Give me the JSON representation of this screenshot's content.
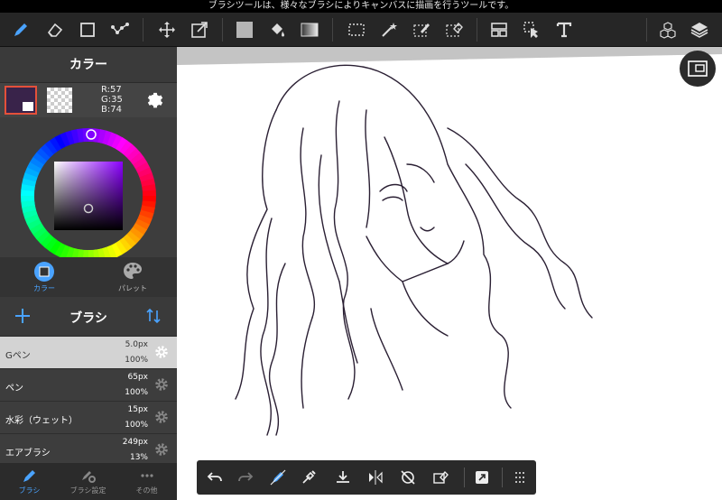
{
  "tooltip": "ブラシツールは、様々なブラシによりキャンバスに描画を行うツールです。",
  "color_panel": {
    "title": "カラー",
    "primary_color": "#39234a",
    "rgb": {
      "r": "R:57",
      "g": "G:35",
      "b": "B:74"
    },
    "tabs": [
      {
        "label": "カラー",
        "icon": "color-circle-icon",
        "active": true
      },
      {
        "label": "パレット",
        "icon": "palette-icon",
        "active": false
      }
    ]
  },
  "brush_panel": {
    "title": "ブラシ",
    "brushes": [
      {
        "name": "Gペン",
        "size": "5.0px",
        "opacity": "100%",
        "selected": true
      },
      {
        "name": "ペン",
        "size": "65px",
        "opacity": "100%",
        "selected": false
      },
      {
        "name": "水彩（ウェット）",
        "size": "15px",
        "opacity": "100%",
        "selected": false
      },
      {
        "name": "エアブラシ",
        "size": "249px",
        "opacity": "13%",
        "selected": false
      }
    ]
  },
  "bottom_tabs": [
    {
      "label": "ブラシ",
      "icon": "brush-icon",
      "active": true
    },
    {
      "label": "ブラシ設定",
      "icon": "brush-settings-icon",
      "active": false
    },
    {
      "label": "その他",
      "icon": "more-icon",
      "active": false
    }
  ],
  "toolbar": {
    "tools": [
      "brush-icon",
      "eraser-icon",
      "shape-icon",
      "dot-line-icon",
      "move-icon",
      "transform-icon",
      "fill-color-icon",
      "bucket-icon",
      "gradient-icon",
      "select-rect-icon",
      "magic-wand-icon",
      "select-pen-icon",
      "select-eraser-icon",
      "frame-icon",
      "operation-icon",
      "text-icon",
      "3d-material-icon",
      "layers-icon"
    ]
  },
  "float_toolbar": {
    "tools": [
      "undo-icon",
      "redo-icon",
      "brush-snap-icon",
      "eyedropper-icon",
      "save-icon",
      "flip-icon",
      "rotate-reset-icon",
      "clear-icon",
      "fullscreen-icon",
      "more-grid-icon"
    ]
  },
  "accent_color": "#4aa3ff"
}
